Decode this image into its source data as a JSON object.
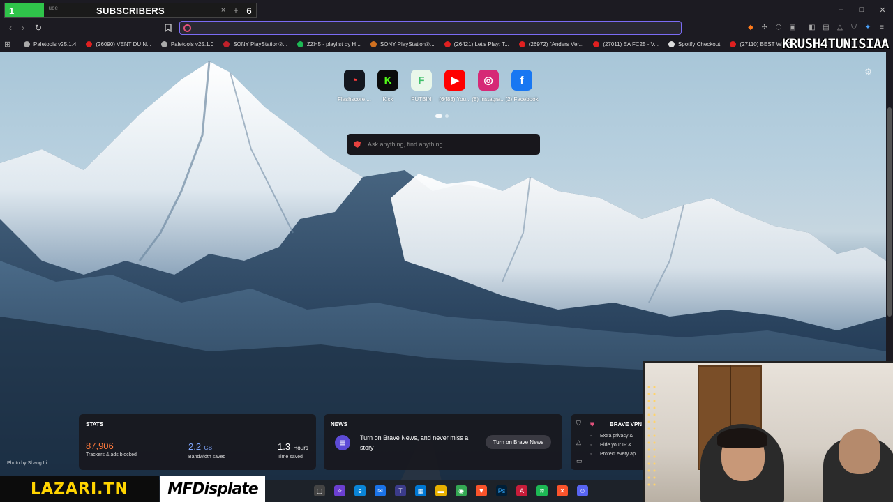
{
  "overlay": {
    "subscriber_count": "1",
    "ghost_tab_text": "Tube",
    "label": "SUBSCRIBERS",
    "close": "×",
    "plus": "+",
    "goal": "6"
  },
  "window_controls": {
    "minimize": "–",
    "maximize": "□",
    "close": "✕"
  },
  "toolbar": {
    "back": "‹",
    "forward": "›",
    "reload": "↻",
    "bookmark": "🔖",
    "url_value": "",
    "url_placeholder": ""
  },
  "bookmarks": [
    {
      "label": "Paletools v25.1.4",
      "color": "#aaaaaa"
    },
    {
      "label": "(26090) VENT DU N...",
      "color": "#e02020"
    },
    {
      "label": "Paletools v25.1.0",
      "color": "#aaaaaa"
    },
    {
      "label": "SONY PlayStation®...",
      "color": "#c0202a"
    },
    {
      "label": "ZZH5 - playlist by H...",
      "color": "#1db954"
    },
    {
      "label": "SONY PlayStation®...",
      "color": "#d07020"
    },
    {
      "label": "(26421) Let's Play: T...",
      "color": "#e02020"
    },
    {
      "label": "(26972) \"Anders Ver...",
      "color": "#e02020"
    },
    {
      "label": "(27011) EA FC25 - V...",
      "color": "#e02020"
    },
    {
      "label": "Spotify Checkout",
      "color": "#dddddd"
    },
    {
      "label": "(27110) BEST WING...",
      "color": "#e02020"
    }
  ],
  "streamer_name": "KRUSH4TUNISIAA",
  "top_sites": [
    {
      "label": "Flashscore....",
      "glyph": "◔",
      "bg": "#14171f",
      "fg": "#ff3b3b"
    },
    {
      "label": "Kick",
      "glyph": "K",
      "bg": "#0b0b0b",
      "fg": "#53fc18"
    },
    {
      "label": "FUTBIN",
      "glyph": "F",
      "bg": "#e9f7ea",
      "fg": "#3fbf6a"
    },
    {
      "label": "(6488) You...",
      "glyph": "▶",
      "bg": "#ff0000",
      "fg": "#ffffff"
    },
    {
      "label": "(8) Instagra...",
      "glyph": "◎",
      "bg": "#d62976",
      "fg": "#ffffff"
    },
    {
      "label": "(2) Facebook",
      "glyph": "f",
      "bg": "#1877f2",
      "fg": "#ffffff"
    }
  ],
  "ask": {
    "placeholder": "Ask anything, find anything..."
  },
  "photo_credit": "Photo by Shang Li",
  "stats": {
    "title": "STATS",
    "trackers_value": "87,906",
    "trackers_label": "Trackers & ads blocked",
    "bandwidth_value": "2.2",
    "bandwidth_unit": "GB",
    "bandwidth_label": "Bandwidth saved",
    "time_value": "1.3",
    "time_unit": "Hours",
    "time_label": "Time saved"
  },
  "news": {
    "title": "NEWS",
    "text": "Turn on Brave News, and never miss a story",
    "button": "Turn on Brave News"
  },
  "vpn": {
    "title": "BRAVE VPN",
    "items": [
      "Extra privacy &",
      "Hide your IP &",
      "Protect every ap"
    ]
  },
  "overlays_bottom": {
    "lazari": "LAZARI.TN",
    "mfd": "MFDisplate"
  },
  "colors": {
    "accent": "#7b6cf5",
    "subscriber_green": "#2fc44a",
    "lazari_yellow": "#ffd400",
    "stats_orange": "#ff7a3c",
    "stats_blue": "#7fa7ff",
    "stats_white": "#ffffff"
  }
}
